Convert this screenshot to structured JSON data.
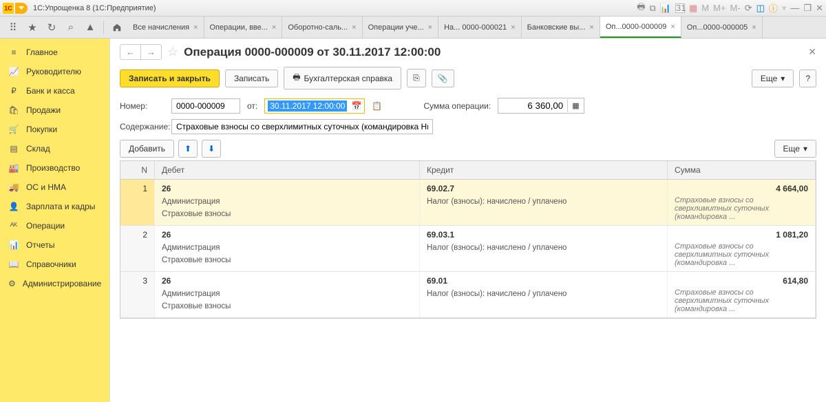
{
  "app_title": "1С:Упрощенка 8  (1С:Предприятие)",
  "calendar_day": "31",
  "m_labels": [
    "M",
    "M+",
    "M-"
  ],
  "tabs": [
    {
      "label": "Все начисления"
    },
    {
      "label": "Операции, вве..."
    },
    {
      "label": "Оборотно-саль..."
    },
    {
      "label": "Операции уче..."
    },
    {
      "label": "На... 0000-000021"
    },
    {
      "label": "Банковские вы..."
    },
    {
      "label": "Оп...0000-000009",
      "active": true
    },
    {
      "label": "Оп...0000-000005"
    }
  ],
  "sidebar": [
    {
      "label": "Главное",
      "icon": "menu"
    },
    {
      "label": "Руководителю",
      "icon": "chart"
    },
    {
      "label": "Банк и касса",
      "icon": "ruble"
    },
    {
      "label": "Продажи",
      "icon": "bag"
    },
    {
      "label": "Покупки",
      "icon": "cart"
    },
    {
      "label": "Склад",
      "icon": "boxes"
    },
    {
      "label": "Производство",
      "icon": "factory"
    },
    {
      "label": "ОС и НМА",
      "icon": "truck"
    },
    {
      "label": "Зарплата и кадры",
      "icon": "person"
    },
    {
      "label": "Операции",
      "icon": "dtkt"
    },
    {
      "label": "Отчеты",
      "icon": "bars"
    },
    {
      "label": "Справочники",
      "icon": "book"
    },
    {
      "label": "Администрирование",
      "icon": "gear"
    }
  ],
  "doc": {
    "title": "Операция 0000-000009 от 30.11.2017 12:00:00",
    "buttons": {
      "save_close": "Записать и закрыть",
      "save": "Записать",
      "report": "Бухгалтерская справка",
      "more": "Еще",
      "add": "Добавить"
    },
    "labels": {
      "number": "Номер:",
      "from": "от:",
      "sum": "Сумма операции:",
      "desc": "Содержание:"
    },
    "number": "0000-000009",
    "date": "30.11.2017 12:00:00",
    "sum": "6 360,00",
    "description": "Страховые взносы со сверхлимитных суточных (командировка Ни"
  },
  "grid": {
    "headers": {
      "n": "N",
      "debit": "Дебет",
      "credit": "Кредит",
      "sum": "Сумма"
    },
    "rows": [
      {
        "n": "1",
        "debit": "26",
        "d1": "Администрация",
        "d2": "Страховые взносы",
        "credit": "69.02.7",
        "c1": "Налог (взносы): начислено / уплачено",
        "sum": "4 664,00",
        "desc": "Страховые взносы со сверхлимитных суточных (командировка ...",
        "active": true
      },
      {
        "n": "2",
        "debit": "26",
        "d1": "Администрация",
        "d2": "Страховые взносы",
        "credit": "69.03.1",
        "c1": "Налог (взносы): начислено / уплачено",
        "sum": "1 081,20",
        "desc": "Страховые взносы со сверхлимитных суточных (командировка ..."
      },
      {
        "n": "3",
        "debit": "26",
        "d1": "Администрация",
        "d2": "Страховые взносы",
        "credit": "69.01",
        "c1": "Налог (взносы): начислено / уплачено",
        "sum": "614,80",
        "desc": "Страховые взносы со сверхлимитных суточных (командировка ..."
      }
    ]
  }
}
